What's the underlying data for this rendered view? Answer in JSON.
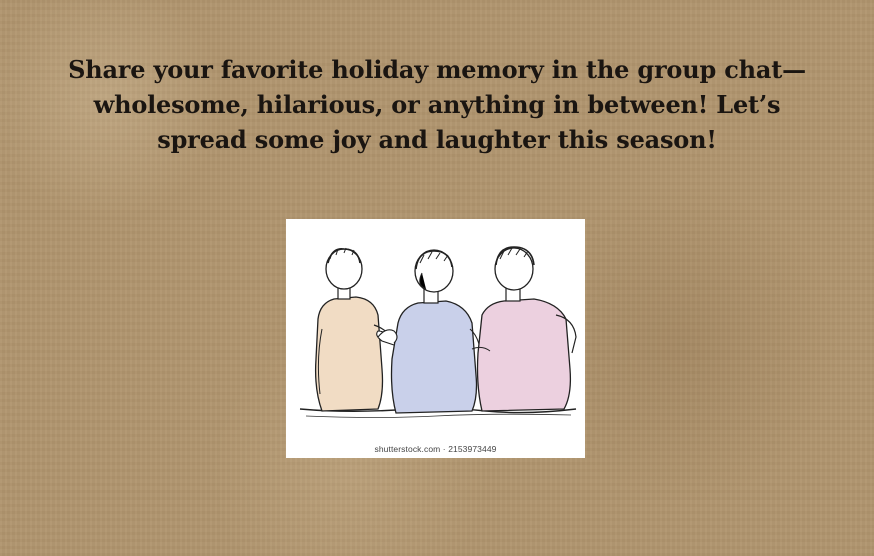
{
  "post": {
    "message": "Share your favorite holiday memory in the group chat—wholesome, hilarious, or anything in between! Let’s spread some joy and laughter this season!"
  },
  "illustration": {
    "subject": "three-friends-sitting-sketch",
    "watermark": "shutterstock.com · 2153973449",
    "shirt_colors": [
      "#f1dcc4",
      "#c9d0ea",
      "#ecd0df"
    ]
  },
  "background": {
    "texture": "kraft-paper",
    "color": "#b0956e"
  }
}
